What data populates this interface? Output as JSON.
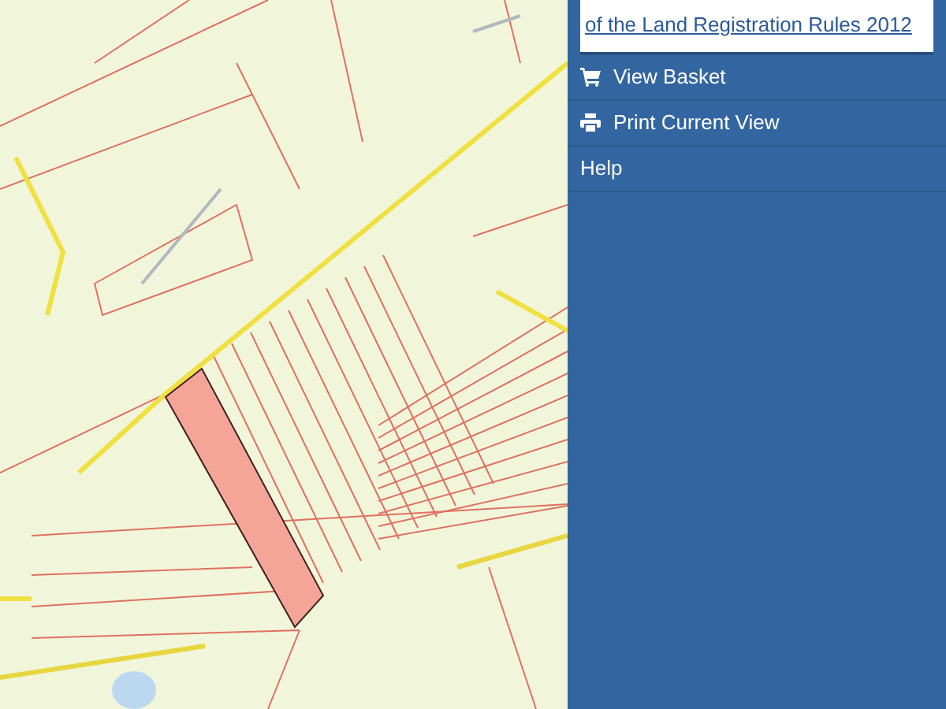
{
  "notice": {
    "link": "of the Land Registration Rules 2012"
  },
  "menu": [
    {
      "kind": "basket",
      "label": "View Basket"
    },
    {
      "kind": "print",
      "label": "Print Current View"
    },
    {
      "kind": "plain",
      "label": "Help"
    }
  ]
}
